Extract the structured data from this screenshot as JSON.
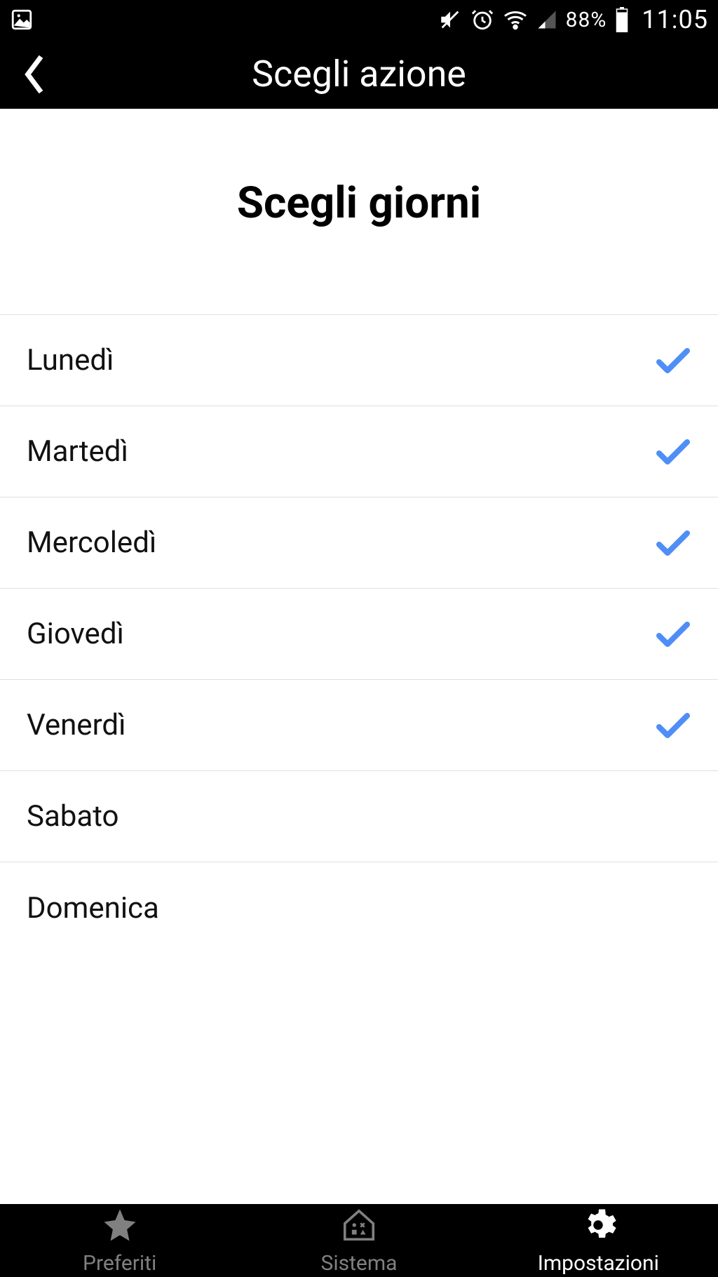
{
  "status": {
    "battery_pct": "88%",
    "clock": "11:05"
  },
  "header": {
    "title": "Scegli azione"
  },
  "content": {
    "section_title": "Scegli giorni",
    "days": [
      {
        "label": "Lunedì",
        "checked": true
      },
      {
        "label": "Martedì",
        "checked": true
      },
      {
        "label": "Mercoledì",
        "checked": true
      },
      {
        "label": "Giovedì",
        "checked": true
      },
      {
        "label": "Venerdì",
        "checked": true
      },
      {
        "label": "Sabato",
        "checked": false
      },
      {
        "label": "Domenica",
        "checked": false
      }
    ]
  },
  "nav": {
    "items": [
      {
        "label": "Preferiti",
        "icon": "star",
        "active": false
      },
      {
        "label": "Sistema",
        "icon": "house",
        "active": false
      },
      {
        "label": "Impostazioni",
        "icon": "gear",
        "active": true
      }
    ]
  },
  "colors": {
    "check": "#4F8EF7",
    "inactive": "#808080"
  }
}
